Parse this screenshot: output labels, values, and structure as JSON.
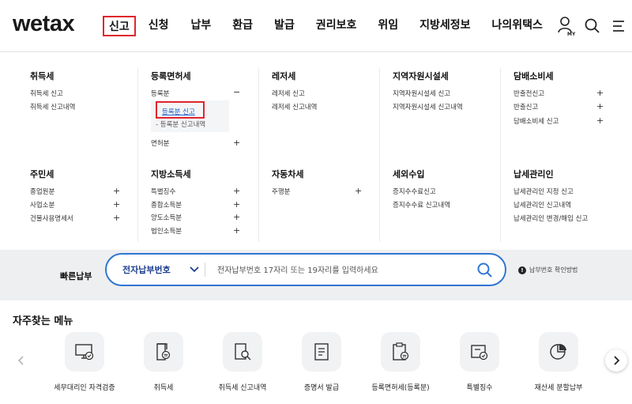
{
  "header": {
    "logo_text": "wetax",
    "nav": [
      "신고",
      "신청",
      "납부",
      "환급",
      "발급",
      "권리보호",
      "위임",
      "지방세정보",
      "나의위택스"
    ],
    "my_label": "MY"
  },
  "menu": {
    "col1": {
      "title1": "취득세",
      "items1": [
        "취득세 신고",
        "취득세 신고내역"
      ],
      "title2": "주민세",
      "items2": [
        "종업원분",
        "사업소분",
        "건물사용명세서"
      ]
    },
    "col2": {
      "title1": "등록면허세",
      "item_registration": "등록분",
      "minus": "−",
      "sub1": "등록분 신고",
      "sub2": "- 등록분 신고내역",
      "item_license": "면허분",
      "title2": "지방소득세",
      "items2": [
        "특별징수",
        "종합소득분",
        "양도소득분",
        "법인소득분"
      ]
    },
    "col3": {
      "title1": "레저세",
      "items1": [
        "레저세 신고",
        "레저세 신고내역"
      ],
      "title2": "자동차세",
      "items2": [
        "주행분"
      ]
    },
    "col4": {
      "title1": "지역자원시설세",
      "items1": [
        "지역자원시설세 신고",
        "지역자원시설세 신고내역"
      ],
      "title2": "세외수입",
      "items2": [
        "증지수수료신고",
        "증지수수료 신고내역"
      ]
    },
    "col5": {
      "title1": "담배소비세",
      "items1": [
        "반출전신고",
        "반출신고",
        "담배소비세 신고"
      ],
      "title2": "납세관리인",
      "items2": [
        "납세관리인 지정 신고",
        "납세관리인 신고내역",
        "납세관리인 변경/해임 신고"
      ]
    },
    "plus": "+"
  },
  "quick_pay": {
    "label": "빠른납부",
    "select": "전자납부번호",
    "placeholder": "전자납부번호 17자리 또는 19자리를 입력하세요",
    "help": "납부번호 확인방법"
  },
  "frequent": {
    "title": "자주찾는 메뉴",
    "items": [
      "세무대리인 자격검증",
      "취득세",
      "취득세 신고내역",
      "증명서 발급",
      "등록면허세(등록분)",
      "특별징수",
      "재산세 분할납부"
    ]
  },
  "colors": {
    "accent": "#2f76d2",
    "highlight": "#e0262d",
    "navy": "#1d3f8f"
  }
}
